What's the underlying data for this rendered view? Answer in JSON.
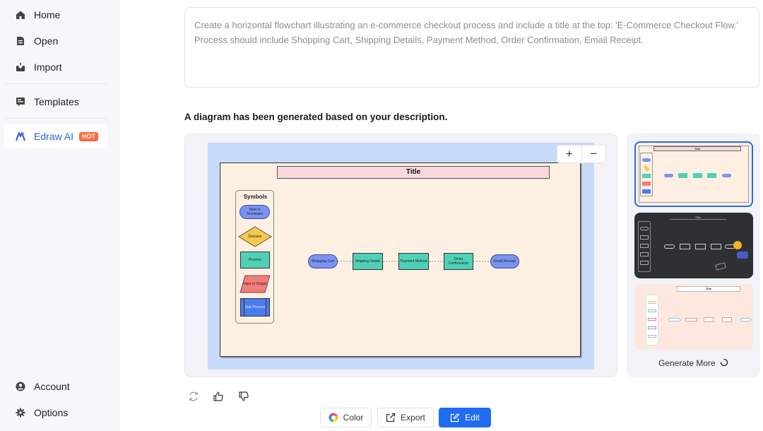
{
  "sidebar": {
    "items": [
      {
        "label": "Home",
        "icon": "home-icon"
      },
      {
        "label": "Open",
        "icon": "file-icon"
      },
      {
        "label": "Import",
        "icon": "import-icon"
      },
      {
        "label": "Templates",
        "icon": "templates-icon"
      },
      {
        "label": "Edraw AI",
        "icon": "edraw-ai-icon",
        "badge": "HOT"
      },
      {
        "label": "Account",
        "icon": "account-icon"
      },
      {
        "label": "Options",
        "icon": "gear-icon"
      }
    ]
  },
  "prompt": {
    "line1": "Create a horizontal flowchart illustrating an e-commerce checkout process and include a title at the top: 'E-Commerce Checkout Flow.'",
    "line2": "Process should include Shopping Cart, Shipping Details, Payment Method, Order Confirmation, Email Receipt."
  },
  "result_heading": "A diagram has been generated based on your description.",
  "diagram": {
    "title": "Title",
    "symbols_title": "Symbols",
    "symbols": [
      "Start or Terminator",
      "Decision",
      "Process",
      "Input or Output",
      "Sub Process"
    ],
    "flow": [
      "Shopping Cart",
      "Shipping Details",
      "Payment Method",
      "Order Confirmation",
      "Email Receipt"
    ]
  },
  "zoom": {
    "in": "+",
    "out": "−"
  },
  "thumbnails": {
    "generate_more": "Generate More",
    "title_text": "Title"
  },
  "actions": {
    "color": "Color",
    "export": "Export",
    "edit": "Edit"
  },
  "colors": {
    "accent": "#1f6cf0",
    "terminator": "#7b93f0",
    "decision": "#f6c84c",
    "process": "#4fd1b8",
    "io": "#f47b7b",
    "subprocess": "#4a7cf0"
  }
}
